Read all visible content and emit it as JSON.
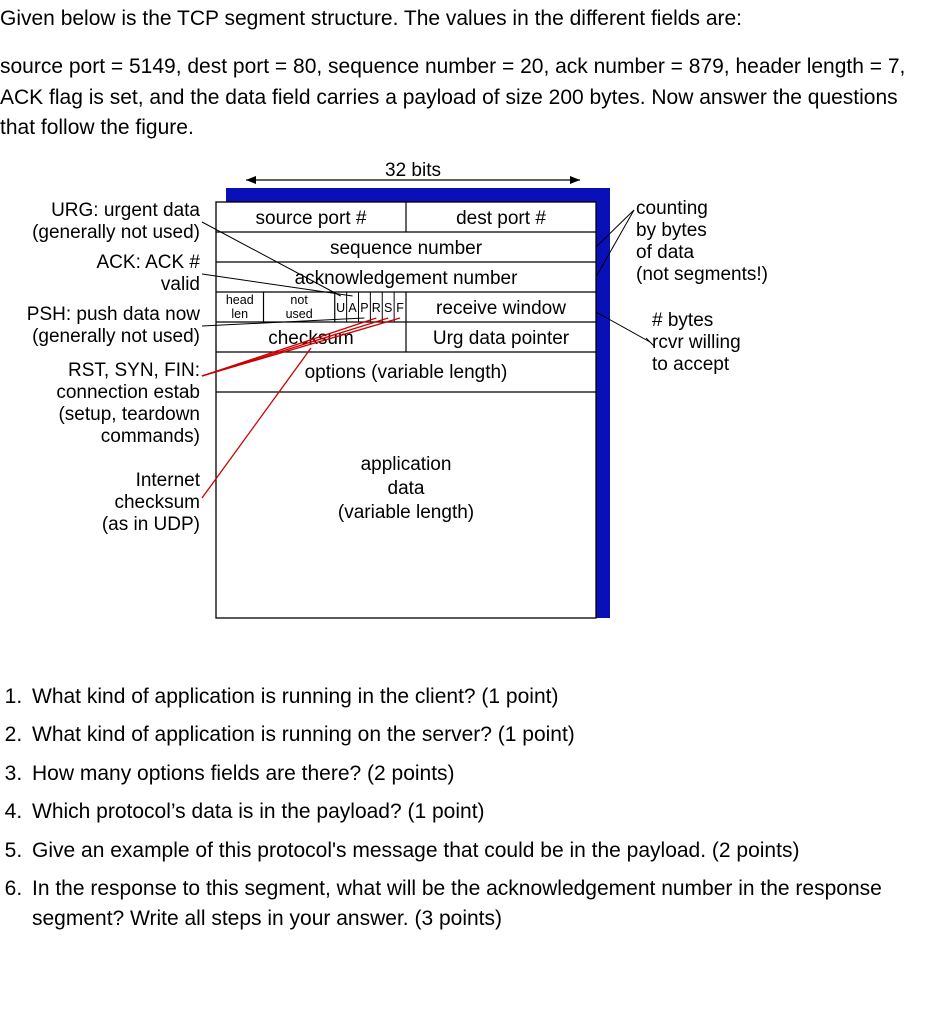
{
  "intro": {
    "line1": "Given below is the TCP segment structure. The values in the different fields are:",
    "line2": "source port = 5149, dest port = 80, sequence number = 20, ack number = 879, header length = 7, ACK flag is set, and the data field carries a payload of size 200 bytes. Now answer the questions that follow the figure."
  },
  "figure": {
    "width_label": "32 bits",
    "cells": {
      "source_port": "source port #",
      "dest_port": "dest port #",
      "sequence_number": "sequence number",
      "ack_number": "acknowledgement number",
      "head_len_top": "head",
      "head_len_bot": "len",
      "not_used_top": "not",
      "not_used_bot": "used",
      "flag_U": "U",
      "flag_A": "A",
      "flag_P": "P",
      "flag_R": "R",
      "flag_S": "S",
      "flag_F": "F",
      "recv_window": "receive window",
      "checksum": "checksum",
      "urg_ptr": "Urg data pointer",
      "options": "options (variable length)",
      "app_data_l1": "application",
      "app_data_l2": "data",
      "app_data_l3": "(variable length)"
    },
    "left_labels": {
      "urg_l1": "URG: urgent data",
      "urg_l2": "(generally not used)",
      "ack_l1": "ACK: ACK #",
      "ack_l2": "valid",
      "psh_l1": "PSH: push data now",
      "psh_l2": "(generally not used)",
      "rsf_l1": "RST, SYN, FIN:",
      "rsf_l2": "connection estab",
      "rsf_l3": "(setup, teardown",
      "rsf_l4": "commands)",
      "ic_l1": "Internet",
      "ic_l2": "checksum",
      "ic_l3": "(as in UDP)"
    },
    "right_labels": {
      "count_l1": "counting",
      "count_l2": "by bytes",
      "count_l3": "of data",
      "count_l4": "(not segments!)",
      "rw_l1": "# bytes",
      "rw_l2": "rcvr willing",
      "rw_l3": "to accept"
    }
  },
  "questions": {
    "q1": "What kind of application is running in the client? (1 point)",
    "q2": "What kind of application is running on the server? (1 point)",
    "q3": "How many options fields are there? (2 points)",
    "q4": "Which protocol’s data is in the payload? (1 point)",
    "q5": "Give an example of this protocol's message that could be in the payload. (2 points)",
    "q6": "In the response to this segment, what will be the acknowledgement number in the response segment? Write all steps in your answer. (3 points)"
  }
}
